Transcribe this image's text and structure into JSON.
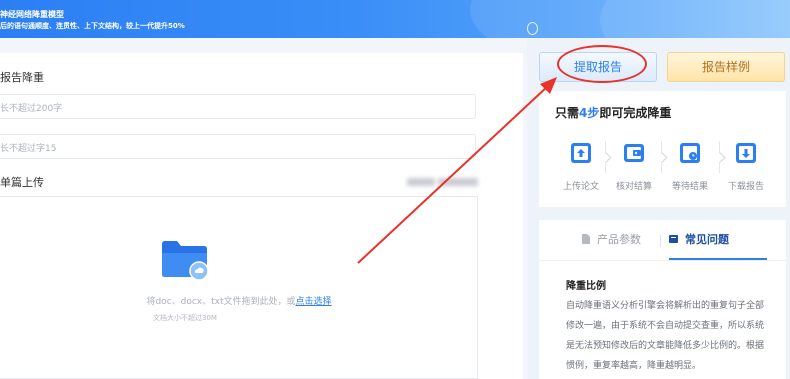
{
  "banner": {
    "line1": "神经网络降重模型",
    "line2": "后的语句通顺度、连贯性、上下文结构，较上一代提升50%"
  },
  "form": {
    "section_title": "报告降重",
    "title_placeholder": "长不超过200字",
    "author_placeholder": "长不超过字15",
    "upload_label": "单篇上传",
    "drop_hint_prefix": "将doc、docx、txt文件拖到此处，或",
    "drop_hint_link": "点击选择",
    "size_limit": "文档大小不超过30M"
  },
  "actions": {
    "extract_label": "提取报告",
    "sample_label": "报告样例"
  },
  "steps": {
    "title_prefix": "只需",
    "title_highlight": "4步",
    "title_suffix": "即可完成降重",
    "items": [
      {
        "label": "上传论文",
        "icon": "upload-icon"
      },
      {
        "label": "核对结算",
        "icon": "wallet-icon"
      },
      {
        "label": "等待结果",
        "icon": "clock-icon"
      },
      {
        "label": "下载报告",
        "icon": "download-icon"
      }
    ]
  },
  "faq": {
    "tabs": [
      "产品参数",
      "常见问题"
    ],
    "active_tab": "常见问题",
    "question": "降重比例",
    "answer": "自动降重语义分析引擎会将解析出的重复句子全部修改一遍，由于系统不会自动提交查重，所以系统是无法预知修改后的文章能降低多少比例的。根据惯例，重复率越高，降重越明显。"
  },
  "colors": {
    "accent": "#2c7ff3",
    "annotation": "#e8322a",
    "sample_button": "#ffe4a8"
  }
}
